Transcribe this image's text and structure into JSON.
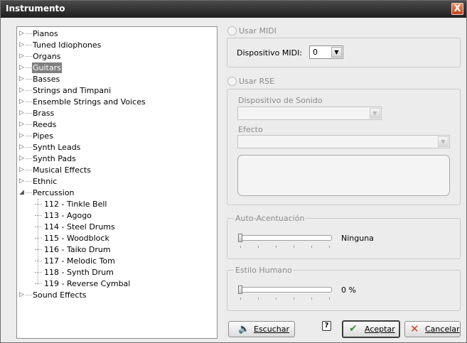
{
  "window": {
    "title": "Instrumento",
    "close_glyph": "X"
  },
  "tree": {
    "categories": [
      {
        "label": "Pianos"
      },
      {
        "label": "Tuned Idiophones"
      },
      {
        "label": "Organs"
      },
      {
        "label": "Guitars"
      },
      {
        "label": "Basses"
      },
      {
        "label": "Strings and Timpani"
      },
      {
        "label": "Ensemble Strings and Voices"
      },
      {
        "label": "Brass"
      },
      {
        "label": "Reeds"
      },
      {
        "label": "Pipes"
      },
      {
        "label": "Synth Leads"
      },
      {
        "label": "Synth Pads"
      },
      {
        "label": "Musical Effects"
      },
      {
        "label": "Ethnic"
      },
      {
        "label": "Percussion"
      },
      {
        "label": "Sound Effects"
      }
    ],
    "percussion_children": [
      "112 - Tinkle Bell",
      "113 - Agogo",
      "114 - Steel Drums",
      "115 - Woodblock",
      "116 - Taiko Drum",
      "117 - Melodic Tom",
      "118 - Synth Drum",
      "119 - Reverse Cymbal"
    ],
    "selected": "Guitars",
    "expanded": "Percussion"
  },
  "midi": {
    "radio_label": "Usar MIDI",
    "device_label": "Dispositivo MIDI:",
    "device_value": "0"
  },
  "rse": {
    "radio_label": "Usar RSE",
    "sound_device_label": "Dispositivo de Sonido",
    "effect_label": "Efecto"
  },
  "auto_accent": {
    "legend": "Auto-Acentuación",
    "value_text": "Ninguna",
    "level": 0
  },
  "human_style": {
    "legend": "Estilo Humano",
    "value_text": "0 %",
    "level": 0
  },
  "buttons": {
    "listen_label": "Escuchar",
    "accept_label": "Aceptar",
    "cancel_label": "Cancelar",
    "help_glyph": "?"
  },
  "colors": {
    "selection": "#7f7f7f",
    "accept_check": "#2e9a2e",
    "cancel_x": "#d23a1f"
  }
}
